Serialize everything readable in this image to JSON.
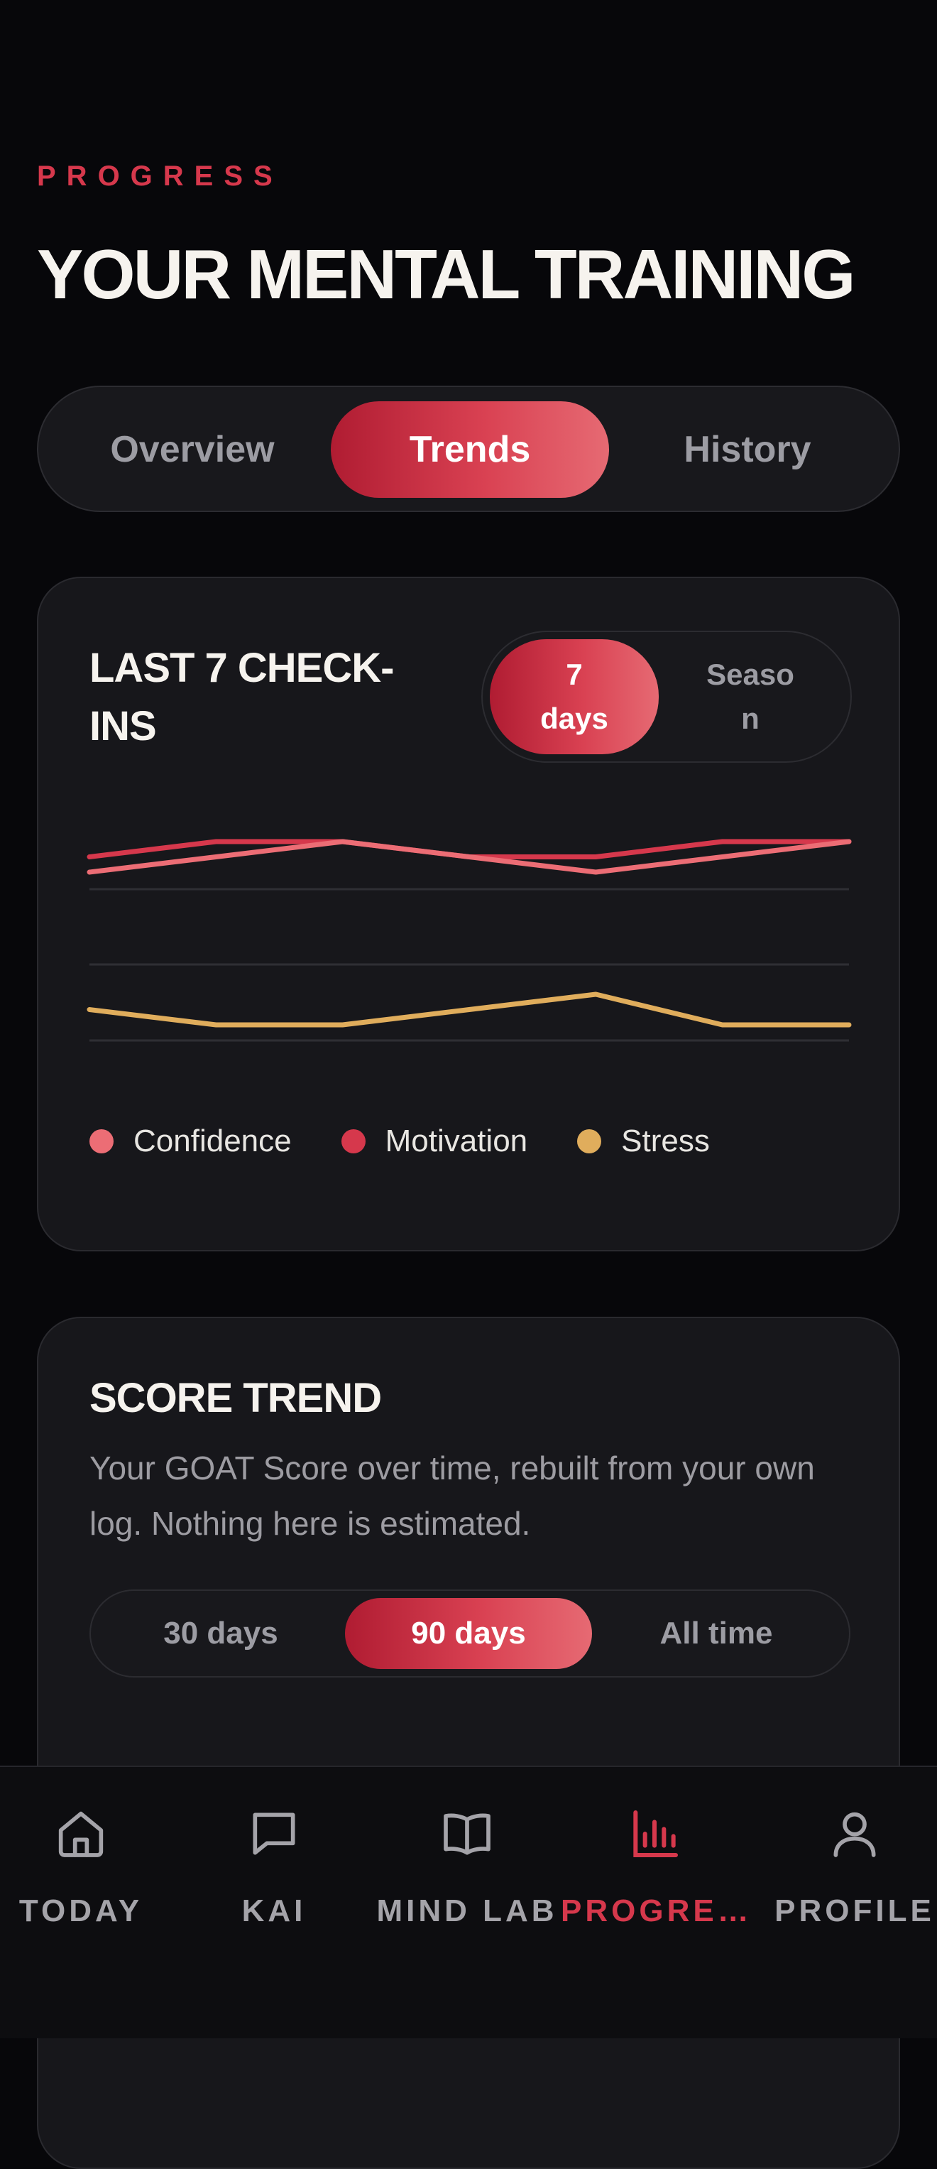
{
  "header": {
    "eyebrow": "PROGRESS",
    "title": "YOUR MENTAL TRAINING"
  },
  "tabs": [
    {
      "label": "Overview",
      "active": false
    },
    {
      "label": "Trends",
      "active": true
    },
    {
      "label": "History",
      "active": false
    }
  ],
  "checkins": {
    "title_line1": "LAST 7 CHECK-",
    "title_line2": "INS",
    "range": [
      {
        "line1": "7",
        "line2": "days",
        "active": true
      },
      {
        "line1": "Seaso",
        "line2": "n",
        "active": false
      }
    ],
    "legend": [
      {
        "label": "Confidence",
        "color": "#ec6d75"
      },
      {
        "label": "Motivation",
        "color": "#d6384c"
      },
      {
        "label": "Stress",
        "color": "#e0ad5c"
      }
    ]
  },
  "chart_data": {
    "type": "line",
    "title": "LAST 7 CHECK-INS",
    "x": [
      1,
      2,
      3,
      4,
      5,
      6,
      7
    ],
    "ylim": [
      0,
      10
    ],
    "grid": true,
    "legend_position": "bottom",
    "series": [
      {
        "name": "Motivation",
        "color": "#d6384c",
        "values": [
          8.4,
          8.8,
          8.8,
          8.4,
          8.4,
          8.8,
          8.8
        ]
      },
      {
        "name": "Confidence",
        "color": "#ec6d75",
        "values": [
          8.0,
          8.4,
          8.8,
          8.4,
          8.0,
          8.4,
          8.8
        ]
      },
      {
        "name": "Stress",
        "color": "#e0ad5c",
        "values": [
          4.4,
          4.0,
          4.0,
          4.4,
          4.8,
          4.0,
          4.0
        ]
      }
    ]
  },
  "score": {
    "title": "SCORE TREND",
    "description": "Your GOAT Score over time, rebuilt from your own log. Nothing here is estimated.",
    "tabs": [
      {
        "label": "30 days",
        "active": false
      },
      {
        "label": "90 days",
        "active": true
      },
      {
        "label": "All time",
        "active": false
      }
    ]
  },
  "nav": {
    "items": [
      {
        "label": "TODAY",
        "icon": "home-icon",
        "active": false
      },
      {
        "label": "KAI",
        "icon": "chat-bubble-icon",
        "active": false
      },
      {
        "label": "MIND LAB",
        "icon": "book-icon",
        "active": false
      },
      {
        "label": "PROGRE…",
        "icon": "bar-chart-icon",
        "active": true
      },
      {
        "label": "PROFILE",
        "icon": "person-icon",
        "active": false
      }
    ],
    "accent": "#d6384c",
    "inactive_color": "#a4a3a9"
  }
}
